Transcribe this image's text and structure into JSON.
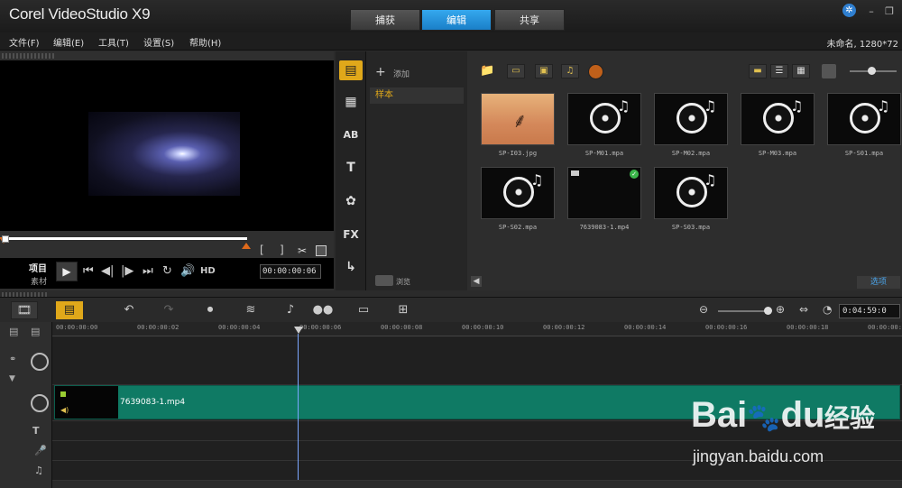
{
  "app": {
    "title": "Corel VideoStudio X9"
  },
  "tabs": [
    {
      "label": "捕获"
    },
    {
      "label": "编辑"
    },
    {
      "label": "共享"
    }
  ],
  "window_controls": {
    "minimize": "–",
    "restore": "❐"
  },
  "menu": [
    {
      "label": "文件(F)"
    },
    {
      "label": "编辑(E)"
    },
    {
      "label": "工具(T)"
    },
    {
      "label": "设置(S)"
    },
    {
      "label": "帮助(H)"
    }
  ],
  "project_info": "未命名, 1280*72",
  "preview": {
    "mode_project": "项目",
    "mode_clip": "素材",
    "hd_label": "HD",
    "timecode": "00:00:00:06",
    "bracket_in": "[",
    "bracket_out": "]",
    "scrub_position": 1.0
  },
  "sidebar": [
    {
      "icon": "media-icon"
    },
    {
      "icon": "instant-project-icon"
    },
    {
      "icon": "transition-icon",
      "label": "AB"
    },
    {
      "icon": "title-icon",
      "label": "T"
    },
    {
      "icon": "graphic-icon"
    },
    {
      "icon": "filter-icon",
      "label": "FX"
    },
    {
      "icon": "path-icon"
    }
  ],
  "library": {
    "add_label": "添加",
    "folder": "样本",
    "browse_label": "浏览",
    "options_label": "选项",
    "items": [
      {
        "name": "SP-I03.jpg",
        "kind": "image"
      },
      {
        "name": "SP-M01.mpa",
        "kind": "audio"
      },
      {
        "name": "SP-M02.mpa",
        "kind": "audio"
      },
      {
        "name": "SP-M03.mpa",
        "kind": "audio"
      },
      {
        "name": "SP-S01.mpa",
        "kind": "audio"
      },
      {
        "name": "SP-S02.mpa",
        "kind": "audio"
      },
      {
        "name": "7639083-1.mp4",
        "kind": "video"
      },
      {
        "name": "SP-S03.mpa",
        "kind": "audio"
      }
    ]
  },
  "timeline": {
    "duration": "0:04:59:0",
    "ruler": [
      "00:00:00:00",
      "00:00:00:02",
      "00:00:00:04",
      "00:00:00:06",
      "00:00:00:08",
      "00:00:00:10",
      "00:00:00:12",
      "00:00:00:14",
      "00:00:00:16",
      "00:00:00:18",
      "00:00:00:2"
    ],
    "clip_label": "7639083-1.mp4",
    "track_icons": [
      "video-track-icon",
      "overlay-track-icon",
      "title-track-icon",
      "voice-track-icon",
      "music-track-icon"
    ]
  },
  "watermark": {
    "brand": "Bai",
    "brand2": "du",
    "cn": "经验",
    "url": "jingyan.baidu.com"
  },
  "colors": {
    "accent": "#1f8fd8",
    "clip": "#0f7a64",
    "scrub": "#ffffff",
    "handle": "#e06a1b",
    "playhead": "#7ba7ff"
  }
}
